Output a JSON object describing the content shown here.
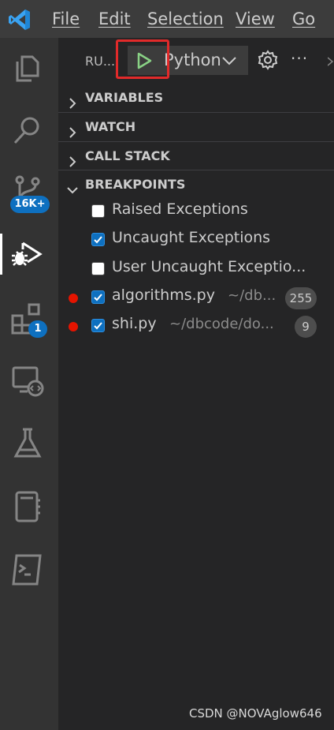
{
  "menu": {
    "file": "File",
    "edit": "Edit",
    "selection": "Selection",
    "view": "View",
    "go": "Go"
  },
  "activity": {
    "scm_badge": "16K+",
    "extensions_badge": "1"
  },
  "run": {
    "label": "RU...",
    "configuration": "Python"
  },
  "sections": {
    "variables": "VARIABLES",
    "watch": "WATCH",
    "call_stack": "CALL STACK",
    "breakpoints": "BREAKPOINTS"
  },
  "breakpoints": {
    "exceptions": [
      {
        "label": "Raised Exceptions",
        "checked": false
      },
      {
        "label": "Uncaught Exceptions",
        "checked": true
      },
      {
        "label": "User Uncaught Exceptio...",
        "checked": false
      }
    ],
    "files": [
      {
        "name": "algorithms.py",
        "path": "~/db...",
        "line": "255",
        "checked": true
      },
      {
        "name": "shi.py",
        "path": "~/dbcode/do...",
        "line": "9",
        "checked": true
      }
    ]
  },
  "colors": {
    "accent": "#0e70c0",
    "breakpoint": "#e51400",
    "highlight_box": "#e12a2a",
    "play": "#89d185"
  },
  "watermark": "CSDN @NOVAglow646"
}
